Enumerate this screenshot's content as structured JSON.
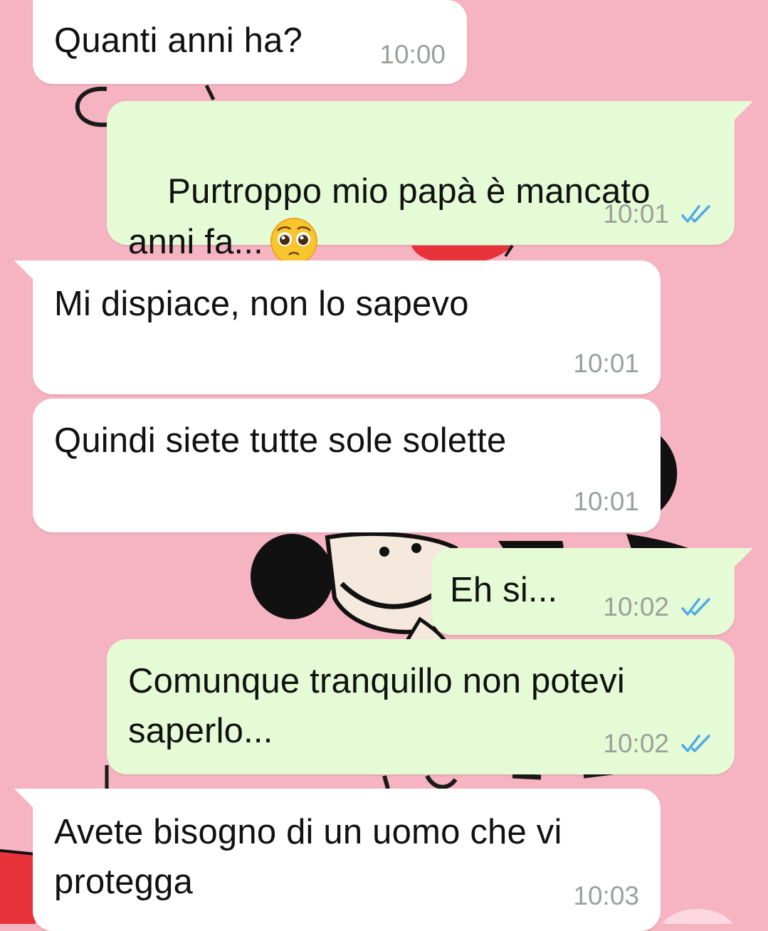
{
  "colors": {
    "wallpaper": "#f6b3c1",
    "incoming_bubble": "#ffffff",
    "outgoing_bubble": "#e5fbd6",
    "read_ticks": "#4fa9e6",
    "timestamp": "#9aa09b"
  },
  "messages": [
    {
      "direction": "incoming",
      "text": "Quanti anni ha?",
      "time": "10:00"
    },
    {
      "direction": "outgoing",
      "text": "Purtroppo mio papà è mancato\nanni fa...",
      "emoji": "pleading-face",
      "time": "10:01",
      "status": "read"
    },
    {
      "direction": "incoming",
      "text": "Mi dispiace, non lo sapevo",
      "time": "10:01"
    },
    {
      "direction": "incoming",
      "text": "Quindi siete tutte sole solette",
      "time": "10:01"
    },
    {
      "direction": "outgoing",
      "text": "Eh si...",
      "time": "10:02",
      "status": "read"
    },
    {
      "direction": "outgoing",
      "text": "Comunque tranquillo non potevi\nsaperlo...",
      "time": "10:02",
      "status": "read"
    },
    {
      "direction": "incoming",
      "text": "Avete bisogno di un uomo che vi\nprotegga",
      "time": "10:03"
    }
  ]
}
